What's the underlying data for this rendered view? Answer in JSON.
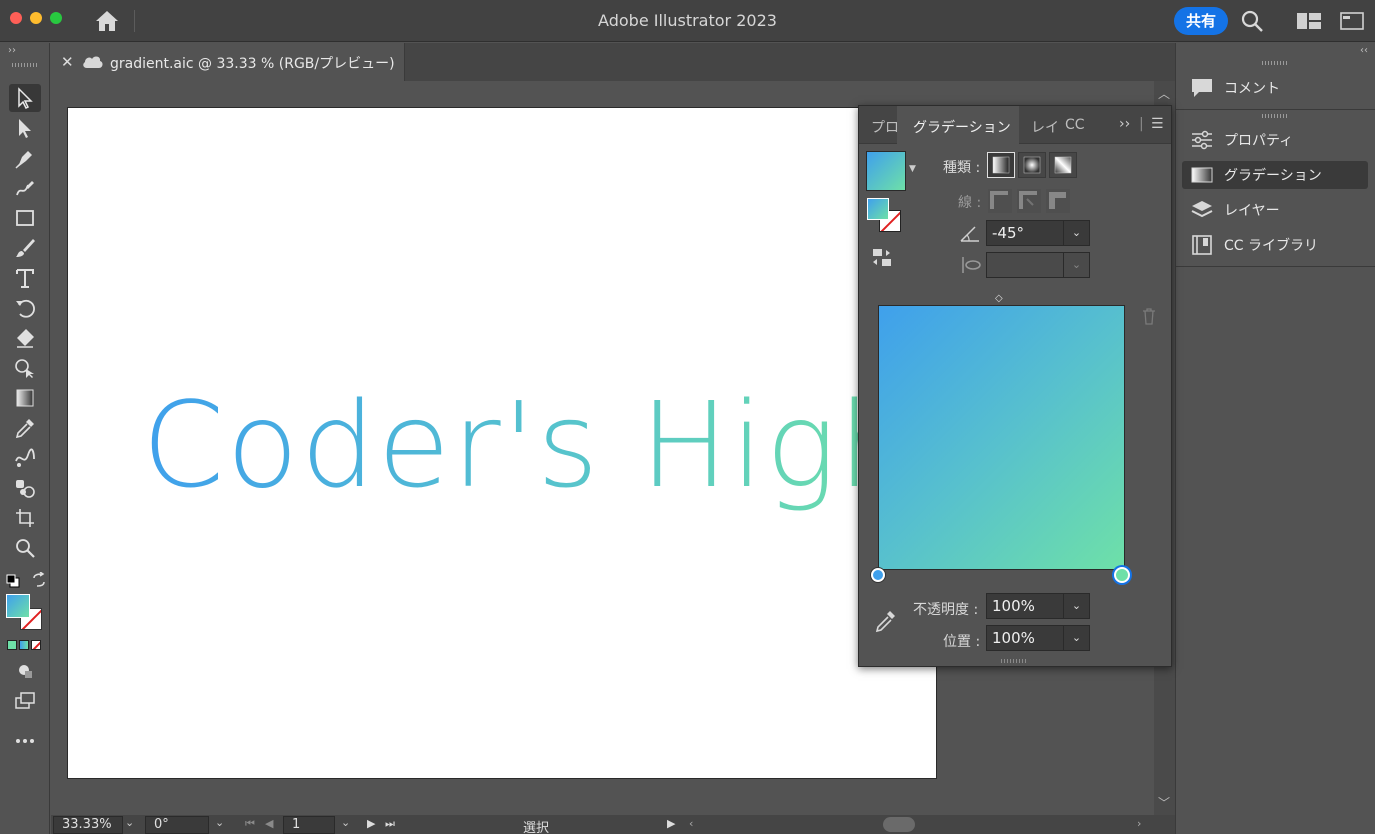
{
  "app": {
    "title": "Adobe Illustrator 2023",
    "share_label": "共有"
  },
  "document": {
    "tab_name": "gradient.aic @ 33.33 % (RGB/プレビュー)",
    "artboard_text": "Coder's High"
  },
  "statusbar": {
    "zoom": "33.33%",
    "rotation": "0°",
    "artboard_number": "1",
    "mode": "選択"
  },
  "gradient_panel": {
    "tabs": {
      "properties_short": "プロ",
      "gradient": "グラデーション",
      "layers_short": "レイ",
      "cc_short": "CC"
    },
    "type_label": "種類 :",
    "stroke_label": "線 :",
    "angle_value": "-45°",
    "opacity_label": "不透明度 :",
    "opacity_value": "100%",
    "location_label": "位置 :",
    "location_value": "100%"
  },
  "dock": {
    "comments": "コメント",
    "properties": "プロパティ",
    "gradient": "グラデーション",
    "layers": "レイヤー",
    "cc_libraries": "CC ライブラリ"
  },
  "colors": {
    "gradient_start": "#3fa0ec",
    "gradient_end": "#6ee0a8",
    "accent_blue": "#1473e6"
  }
}
